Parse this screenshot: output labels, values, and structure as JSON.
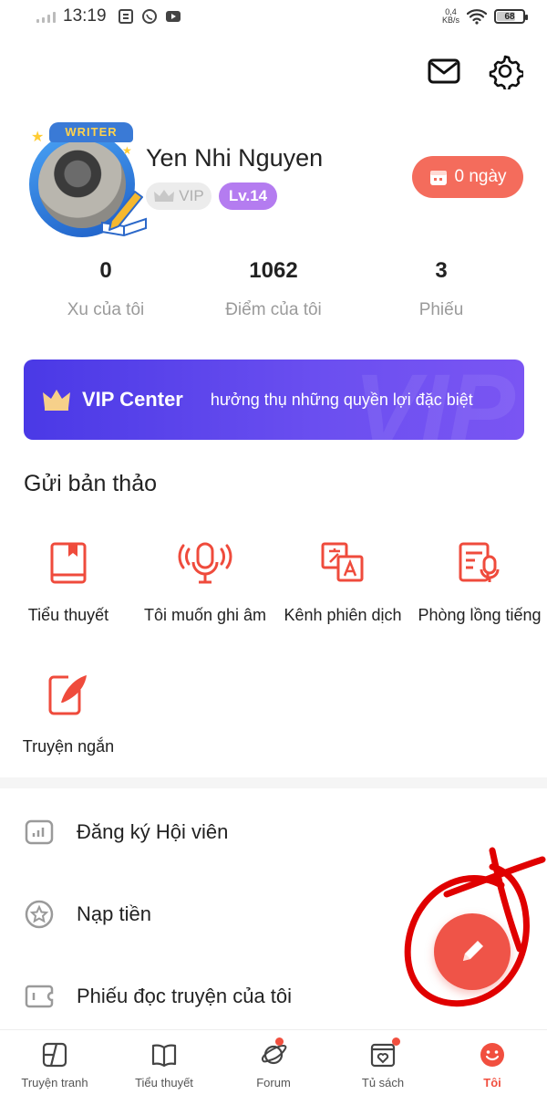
{
  "status_bar": {
    "time": "13:19",
    "net_speed_value": "0,4",
    "net_speed_unit": "KB/s",
    "battery": "68"
  },
  "header": {
    "mail_icon": "mail-icon",
    "settings_icon": "gear-icon"
  },
  "profile": {
    "avatar_badge": "WRITER",
    "name": "Yen Nhi Nguyen",
    "vip_label": "VIP",
    "level": "Lv.14",
    "checkin_label": "0 ngày"
  },
  "stats": [
    {
      "value": "0",
      "label": "Xu của tôi"
    },
    {
      "value": "1062",
      "label": "Điểm của tôi"
    },
    {
      "value": "3",
      "label": "Phiếu"
    }
  ],
  "vip_banner": {
    "title": "VIP Center",
    "subtitle": "hưởng thụ những quyền lợi đặc biệt",
    "watermark": "VIP"
  },
  "submit_section": {
    "title": "Gửi bản thảo",
    "items": [
      {
        "label": "Tiểu thuyết",
        "icon": "book-icon"
      },
      {
        "label": "Tôi muốn ghi âm",
        "icon": "microphone-icon"
      },
      {
        "label": "Kênh phiên dịch",
        "icon": "translate-icon"
      },
      {
        "label": "Phòng lồng tiếng",
        "icon": "dubbing-icon"
      },
      {
        "label": "Truyện ngắn",
        "icon": "quill-icon"
      }
    ]
  },
  "menu": [
    {
      "label": "Đăng ký Hội viên",
      "icon": "membership-chart-icon"
    },
    {
      "label": "Nạp tiền",
      "icon": "star-coin-icon"
    },
    {
      "label": "Phiếu đọc truyện của tôi",
      "icon": "ticket-icon"
    }
  ],
  "tabbar": [
    {
      "label": "Truyện tranh",
      "icon": "comic-icon",
      "dot": false,
      "active": false
    },
    {
      "label": "Tiểu thuyết",
      "icon": "open-book-icon",
      "dot": false,
      "active": false
    },
    {
      "label": "Forum",
      "icon": "planet-icon",
      "dot": true,
      "active": false
    },
    {
      "label": "Tủ sách",
      "icon": "bookshelf-icon",
      "dot": true,
      "active": false
    },
    {
      "label": "Tôi",
      "icon": "smile-face-icon",
      "dot": false,
      "active": true
    }
  ],
  "colors": {
    "accent": "#f14f3f",
    "checkin": "#f46c5c",
    "level_pill": "#b47cf0",
    "vip_banner_start": "#4a39e6",
    "vip_banner_end": "#7a55f3"
  }
}
